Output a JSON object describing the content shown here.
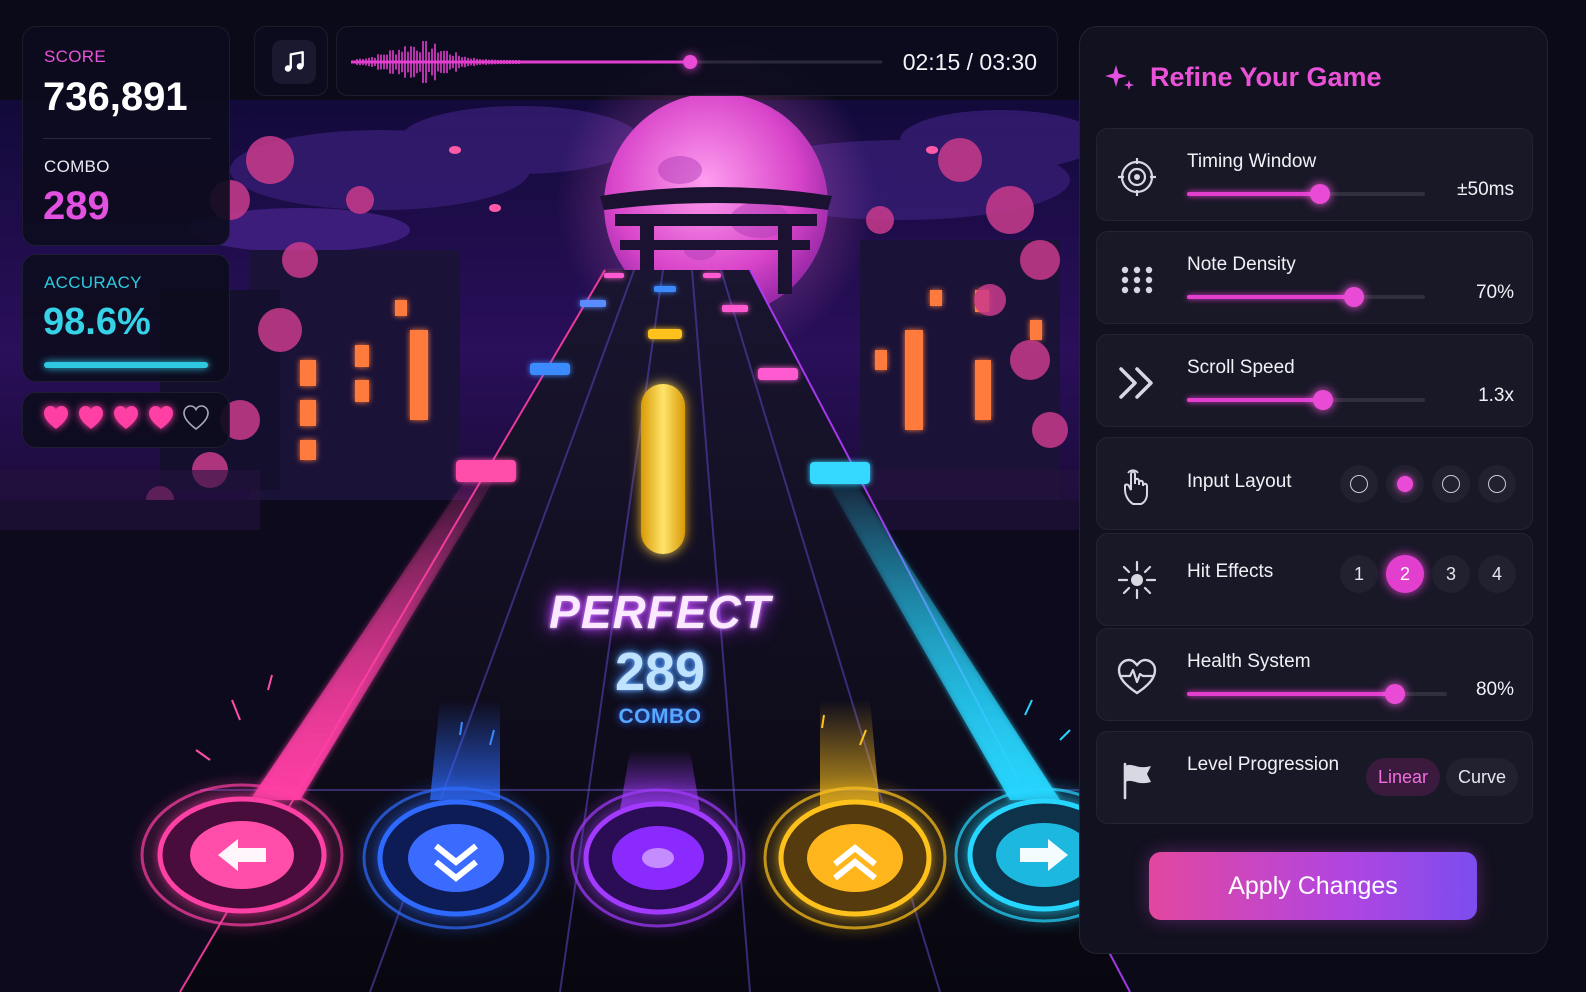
{
  "hud": {
    "score_label": "SCORE",
    "score": "736,891",
    "combo_label": "COMBO",
    "combo": "289",
    "accuracy_label": "ACCURACY",
    "accuracy": "98.6%",
    "accuracy_fraction": 0.986,
    "lives_filled": 4,
    "lives_total": 5
  },
  "track": {
    "time": "02:15 / 03:30",
    "progress_fraction": 0.64
  },
  "judgement": {
    "word": "PERFECT",
    "combo": "289",
    "combo_label": "COMBO"
  },
  "panel": {
    "title": "Refine Your Game",
    "settings": [
      {
        "label": "Timing Window",
        "icon": "target-icon",
        "type": "slider",
        "level": 0.56,
        "value": "±50ms"
      },
      {
        "label": "Note Density",
        "icon": "dots-grid-icon",
        "type": "slider",
        "level": 0.7,
        "value": "70%"
      },
      {
        "label": "Scroll Speed",
        "icon": "double-chevron-icon",
        "type": "slider",
        "level": 0.57,
        "value": "1.3x"
      },
      {
        "label": "Input Layout",
        "icon": "tap-hand-icon",
        "type": "radio",
        "options": 4,
        "selected": 2
      },
      {
        "label": "Hit Effects",
        "icon": "sparkle-icon",
        "type": "number",
        "options": [
          "1",
          "2",
          "3",
          "4"
        ],
        "selected": "2"
      },
      {
        "label": "Health System",
        "icon": "heartbeat-icon",
        "type": "slider",
        "level": 0.8,
        "value": "80%"
      },
      {
        "label": "Level Progression",
        "icon": "flag-icon",
        "type": "segmented",
        "options": [
          "Linear",
          "Curve"
        ],
        "selected": "Linear"
      }
    ],
    "apply_label": "Apply Changes"
  },
  "colors": {
    "accent_pink": "#e23fcf",
    "accuracy_cyan": "#2ec9e0",
    "combo_magenta": "#e351e0",
    "lane_pink": "#ff3fa4",
    "lane_blue": "#2f6bff",
    "lane_purple": "#a23bff",
    "lane_yellow": "#ffc21f",
    "lane_cyan": "#27d6ff"
  },
  "lanes": [
    {
      "name": "left",
      "icon": "arrow-left-icon"
    },
    {
      "name": "down",
      "icon": "arrow-down-icon"
    },
    {
      "name": "center",
      "icon": "circle-icon"
    },
    {
      "name": "up",
      "icon": "arrow-up-icon"
    },
    {
      "name": "right",
      "icon": "arrow-right-icon"
    }
  ]
}
